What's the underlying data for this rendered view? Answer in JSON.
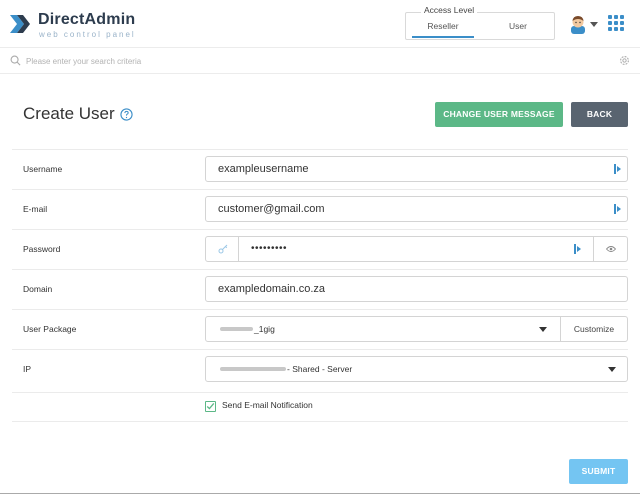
{
  "brand": {
    "title": "DirectAdmin",
    "subtitle": "web control panel"
  },
  "access_level": {
    "legend": "Access Level",
    "tabs": [
      {
        "label": "Reseller",
        "active": true
      },
      {
        "label": "User",
        "active": false
      }
    ]
  },
  "search": {
    "placeholder": "Please enter your search criteria",
    "value": ""
  },
  "page": {
    "title": "Create User",
    "change_message_label": "CHANGE USER MESSAGE",
    "back_label": "BACK"
  },
  "form": {
    "username": {
      "label": "Username",
      "value": "exampleusername"
    },
    "email": {
      "label": "E-mail",
      "value": "customer@gmail.com"
    },
    "password": {
      "label": "Password",
      "value": "•••••••••"
    },
    "domain": {
      "label": "Domain",
      "value": "exampledomain.co.za"
    },
    "package": {
      "label": "User Package",
      "value_suffix": "_1gig",
      "customize_label": "Customize"
    },
    "ip": {
      "label": "IP",
      "value_suffix": "- Shared - Server"
    },
    "notification": {
      "label": "Send E-mail Notification",
      "checked": true
    },
    "submit_label": "SUBMIT"
  },
  "colors": {
    "accent": "#3b8ec8",
    "green": "#5cb887",
    "dark_button": "#596470",
    "submit": "#74c5f2"
  },
  "icons": {
    "logo": "directadmin-chevron-icon",
    "avatar": "user-avatar-icon",
    "apps": "apps-grid-icon",
    "search": "search-icon",
    "settings": "gear-icon",
    "help": "help-icon",
    "keypass": "keypass-icon",
    "generate": "key-generate-icon",
    "eye": "eye-icon",
    "check": "checkmark-icon"
  }
}
